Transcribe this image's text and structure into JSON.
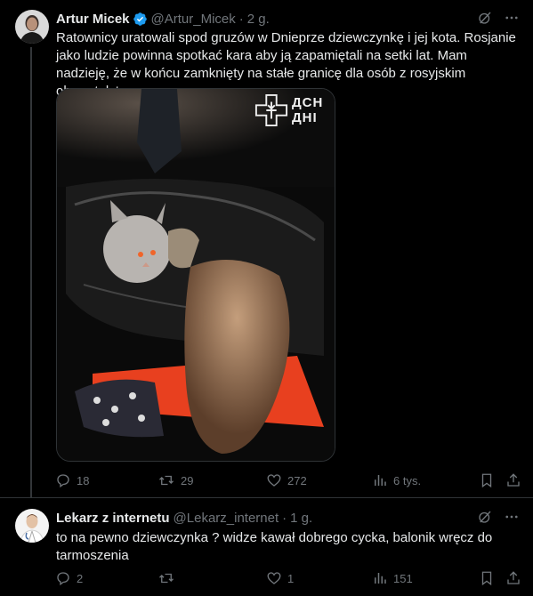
{
  "tweets": [
    {
      "author_name": "Artur Micek",
      "handle": "@Artur_Micek",
      "separator": "·",
      "time": "2 g.",
      "text": "Ratownicy uratowali spod gruzów w Dnieprze dziewczynkę i jej kota. Rosjanie jako ludzie powinna spotkać kara aby ją zapamiętali na setki lat. Mam nadzieję, że w końcu zamknięty na stałe granicę dla osób z rosyjskim obywatelstwem.",
      "media_watermark": [
        "ДСН",
        "ДНІ"
      ],
      "stats": {
        "replies": "18",
        "retweets": "29",
        "likes": "272",
        "views": "6 tys."
      },
      "verified": true
    },
    {
      "author_name": "Lekarz z internetu",
      "handle": "@Lekarz_internet",
      "separator": "·",
      "time": "1 g.",
      "text": "to na pewno dziewczynka ? widze kawał dobrego cycka, balonik wręcz do tarmoszenia",
      "stats": {
        "replies": "2",
        "retweets": "",
        "likes": "1",
        "views": "151"
      },
      "verified": false
    }
  ],
  "colors": {
    "background": "#000000",
    "text": "#e7e9ea",
    "muted": "#71767b",
    "verified": "#1d9bf0",
    "divider": "#2f3336"
  },
  "icons": [
    "grok-icon",
    "more-icon",
    "verified-badge-icon",
    "reply-icon",
    "retweet-icon",
    "like-icon",
    "views-icon",
    "bookmark-icon",
    "share-icon"
  ]
}
